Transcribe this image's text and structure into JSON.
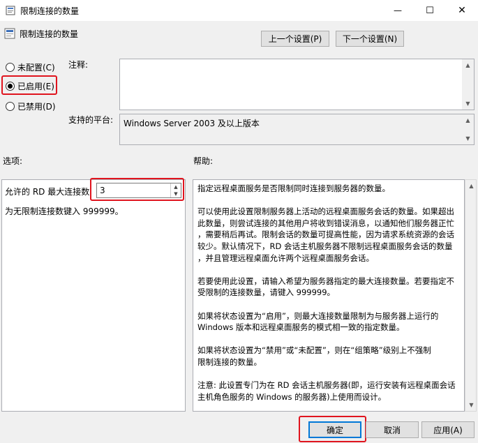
{
  "window": {
    "title": "限制连接的数量",
    "minimize_glyph": "—",
    "maximize_glyph": "☐",
    "close_glyph": "✕"
  },
  "header": {
    "policy_name": "限制连接的数量",
    "prev_button": "上一个设置(P)",
    "next_button": "下一个设置(N)"
  },
  "state": {
    "not_configured": "未配置(C)",
    "enabled": "已启用(E)",
    "disabled": "已禁用(D)",
    "selected": "enabled"
  },
  "comment": {
    "label": "注释:",
    "value": ""
  },
  "platform": {
    "label": "支持的平台:",
    "value": "Windows Server 2003 及以上版本"
  },
  "options": {
    "label": "选项:",
    "max_connections_label": "允许的 RD 最大连接数",
    "max_connections_value": "3",
    "hint": "为无限制连接数键入 999999。"
  },
  "help": {
    "label": "帮助:",
    "lines": [
      "指定远程桌面服务是否限制同时连接到服务器的数量。",
      "",
      "可以使用此设置限制服务器上活动的远程桌面服务会话的数量。如果超出",
      "此数量，则尝试连接的其他用户将收到错误消息，以通知他们服务器正忙",
      "，需要稍后再试。限制会话的数量可提高性能，因为请求系统资源的会话",
      "较少。默认情况下，RD 会话主机服务器不限制远程桌面服务会话的数量",
      "，并且管理远程桌面允许两个远程桌面服务会话。",
      "",
      "若要使用此设置，请输入希望为服务器指定的最大连接数量。若要指定不",
      "受限制的连接数量，请键入 999999。",
      "",
      "如果将状态设置为“启用”，则最大连接数量限制为与服务器上运行的",
      "Windows 版本和远程桌面服务的模式相一致的指定数量。",
      "",
      "如果将状态设置为“禁用”或“未配置”，则在“组策略”级别上不强制",
      "限制连接的数量。",
      "",
      "注意: 此设置专门为在 RD 会话主机服务器(即，运行安装有远程桌面会话",
      "主机角色服务的 Windows 的服务器)上使用而设计。"
    ]
  },
  "footer": {
    "ok": "确定",
    "cancel": "取消",
    "apply": "应用(A)"
  },
  "colors": {
    "highlight": "#e0141e",
    "window_bg": "#f0f0f0"
  }
}
